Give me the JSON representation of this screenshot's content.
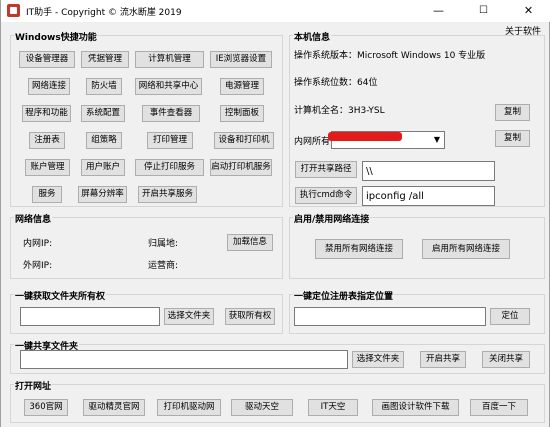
{
  "window": {
    "title": "IT助手 - Copyright © 流水断崖 2019",
    "min_icon": "minimize-icon",
    "max_icon": "maximize-icon",
    "close_icon": "close-icon",
    "min_glyph": "—",
    "max_glyph": "☐",
    "close_glyph": "✕",
    "about": "关于软件"
  },
  "shortcuts": {
    "title": "Windows快捷功能",
    "rows": [
      [
        "设备管理器",
        "凭据管理",
        "计算机管理",
        "IE浏览器设置"
      ],
      [
        "网络连接",
        "防火墙",
        "网络和共享中心",
        "电源管理"
      ],
      [
        "程序和功能",
        "系统配置",
        "事件查看器",
        "控制面板"
      ],
      [
        "注册表",
        "组策略",
        "打印管理",
        "设备和打印机"
      ],
      [
        "账户管理",
        "用户账户",
        "停止打印服务",
        "启动打印机服务"
      ],
      [
        "服务",
        "屏幕分辨率",
        "开启共享服务"
      ]
    ]
  },
  "sysinfo": {
    "title": "本机信息",
    "os_version": "操作系统版本：Microsoft Windows 10 专业版",
    "os_bits": "操作系统位数：64位",
    "computer_name": "计算机全名：3H3-YSL",
    "copy1": "复制",
    "ip_label": "内网所有",
    "copy2": "复制",
    "open_share": "打开共享路径",
    "share_path": "\\\\",
    "run_cmd": "执行cmd命令",
    "cmd_value": "ipconfig /all"
  },
  "netinfo": {
    "title": "网络信息",
    "lan_ip": "内网IP:",
    "location": "归属地:",
    "wan_ip": "外网IP:",
    "isp": "运营商:",
    "load": "加载信息"
  },
  "netctl": {
    "title": "启用/禁用网络连接",
    "disable_all": "禁用所有网络连接",
    "enable_all": "启用所有网络连接"
  },
  "ownership": {
    "title": "一键获取文件夹所有权",
    "select": "选择文件夹",
    "take": "获取所有权"
  },
  "regloc": {
    "title": "一键定位注册表指定位置",
    "locate": "定位"
  },
  "share": {
    "title": "一键共享文件夹",
    "select": "选择文件夹",
    "open": "开启共享",
    "close": "关闭共享"
  },
  "sites": {
    "title": "打开网址",
    "items": [
      "360官网",
      "驱动精灵官网",
      "打印机驱动网",
      "驱动天空",
      "IT天空",
      "画图设计软件下载",
      "百度一下"
    ]
  }
}
